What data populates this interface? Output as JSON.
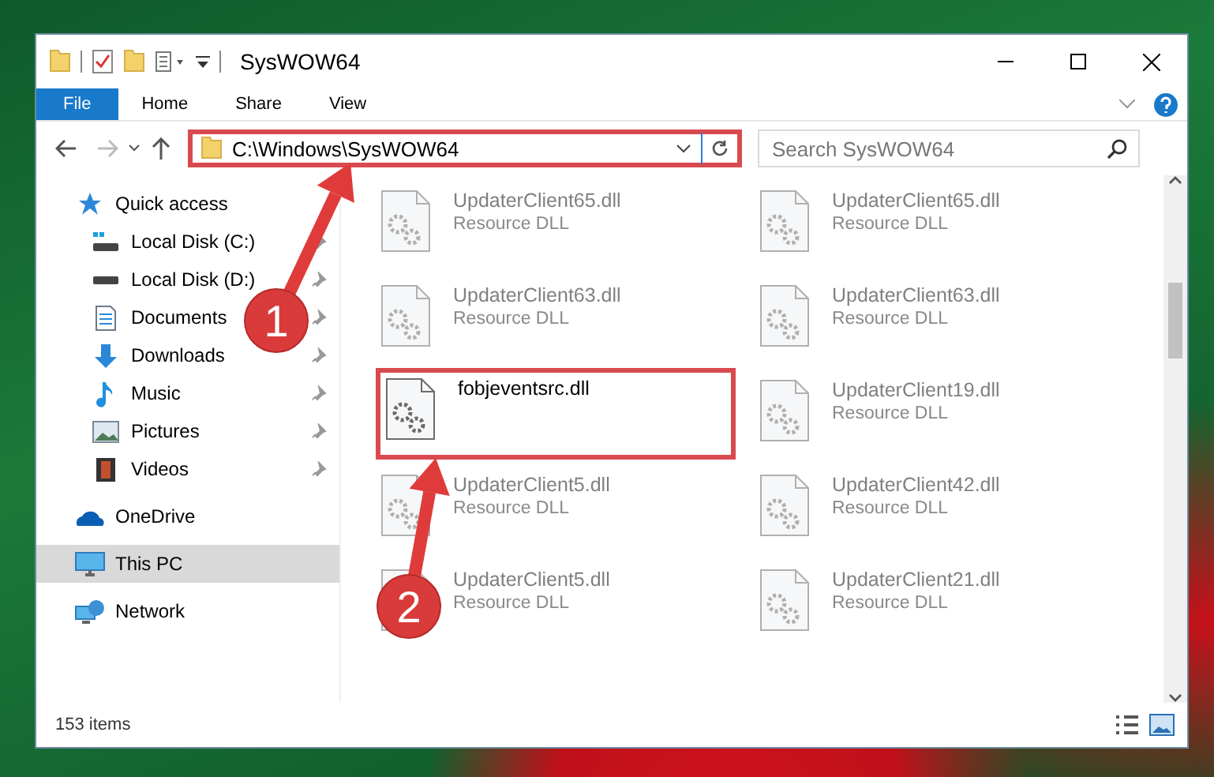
{
  "window": {
    "title": "SysWOW64"
  },
  "ribbon": {
    "tabs": [
      {
        "label": "File",
        "selected": true
      },
      {
        "label": "Home",
        "selected": false
      },
      {
        "label": "Share",
        "selected": false
      },
      {
        "label": "View",
        "selected": false
      }
    ]
  },
  "address_bar": {
    "path": "C:\\Windows\\SysWOW64",
    "highlighted": true
  },
  "search": {
    "placeholder": "Search SysWOW64"
  },
  "sidebar": {
    "items": [
      {
        "label": "Quick access",
        "selected": false,
        "children": [
          {
            "label": "Local Disk (C:)",
            "pinned": true,
            "selected": false
          },
          {
            "label": "Local Disk (D:)",
            "pinned": true,
            "selected": false
          },
          {
            "label": "Documents",
            "pinned": true,
            "selected": false
          },
          {
            "label": "Downloads",
            "pinned": true,
            "selected": false
          },
          {
            "label": "Music",
            "pinned": true,
            "selected": false
          },
          {
            "label": "Pictures",
            "pinned": true,
            "selected": false
          },
          {
            "label": "Videos",
            "pinned": true,
            "selected": false
          }
        ]
      },
      {
        "label": "OneDrive",
        "selected": false
      },
      {
        "label": "This PC",
        "selected": true
      },
      {
        "label": "Network",
        "selected": false
      }
    ]
  },
  "files": [
    {
      "name": "UpdaterClient65.dll",
      "type": "Resource DLL",
      "highlighted": false
    },
    {
      "name": "UpdaterClient65.dll",
      "type": "Resource DLL",
      "highlighted": false
    },
    {
      "name": "UpdaterClient63.dll",
      "type": "Resource DLL",
      "highlighted": false
    },
    {
      "name": "UpdaterClient63.dll",
      "type": "Resource DLL",
      "highlighted": false
    },
    {
      "name": "fobjeventsrc.dll",
      "highlighted": true
    },
    {
      "name": "UpdaterClient19.dll",
      "type": "Resource DLL",
      "highlighted": false
    },
    {
      "name": "UpdaterClient5.dll",
      "type": "Resource DLL",
      "highlighted": false
    },
    {
      "name": "UpdaterClient42.dll",
      "type": "Resource DLL",
      "highlighted": false
    },
    {
      "name": "UpdaterClient5.dll",
      "type": "Resource DLL",
      "highlighted": false
    },
    {
      "name": "UpdaterClient21.dll",
      "type": "Resource DLL",
      "highlighted": false
    }
  ],
  "status_bar": {
    "item_count": "153 items"
  },
  "callouts": [
    {
      "number": "1"
    },
    {
      "number": "2"
    }
  ]
}
